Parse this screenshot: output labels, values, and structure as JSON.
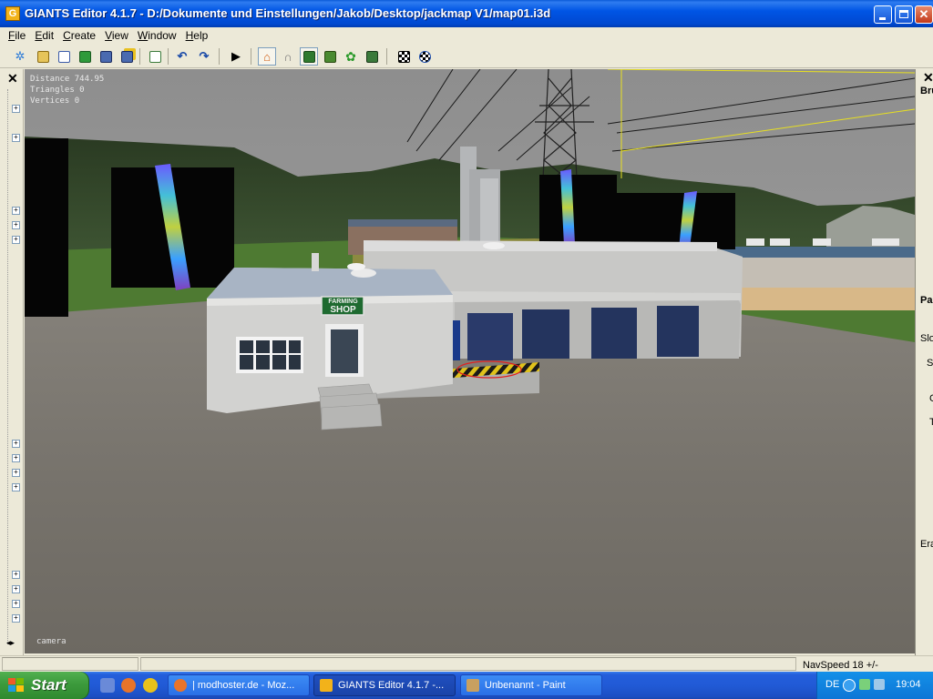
{
  "window": {
    "title": "GIANTS Editor 4.1.7 - D:/Dokumente und Einstellungen/Jakob/Desktop/jackmap V1/map01.i3d",
    "app_icon_letter": "G"
  },
  "menu": {
    "items": [
      {
        "key": "F",
        "rest": "ile"
      },
      {
        "key": "E",
        "rest": "dit"
      },
      {
        "key": "C",
        "rest": "reate"
      },
      {
        "key": "V",
        "rest": "iew"
      },
      {
        "key": "W",
        "rest": "indow"
      },
      {
        "key": "H",
        "rest": "elp"
      }
    ]
  },
  "toolbar": {
    "icons": [
      "new-icon",
      "open-icon",
      "import-icon",
      "refresh-icon",
      "save-icon",
      "save-as-icon",
      "export-icon",
      "undo-icon",
      "redo-icon",
      "play-icon",
      "scene-mode-icon",
      "magnet-icon",
      "terrain-sculpt-icon",
      "terrain-paint-icon",
      "foliage-paint-icon",
      "texture-paint-icon",
      "checker-icon",
      "checker-settings-icon"
    ]
  },
  "viewport": {
    "hud": {
      "distance": "Distance 744.95",
      "triangles": "Triangles 0",
      "vertices": "Vertices 0"
    },
    "camera_label": "camera",
    "shop_sign_line1": "FARMING",
    "shop_sign_line2": "SHOP"
  },
  "right_panel": {
    "labels": [
      "Bru",
      "Pa",
      "Slo",
      "S",
      "C",
      "T",
      "Era"
    ]
  },
  "status": {
    "navspeed": "NavSpeed 18 +/-"
  },
  "taskbar": {
    "start_label": "Start",
    "tasks": [
      {
        "label": "| modhoster.de - Moz...",
        "active": false
      },
      {
        "label": "GIANTS Editor 4.1.7 -...",
        "active": true
      },
      {
        "label": "Unbenannt - Paint",
        "active": false
      }
    ],
    "language": "DE",
    "clock": "19:04"
  },
  "colors": {
    "title_blue": "#0055e5",
    "taskbar_blue": "#245edb",
    "start_green": "#3c9a3c",
    "window_face": "#ece9d8"
  }
}
